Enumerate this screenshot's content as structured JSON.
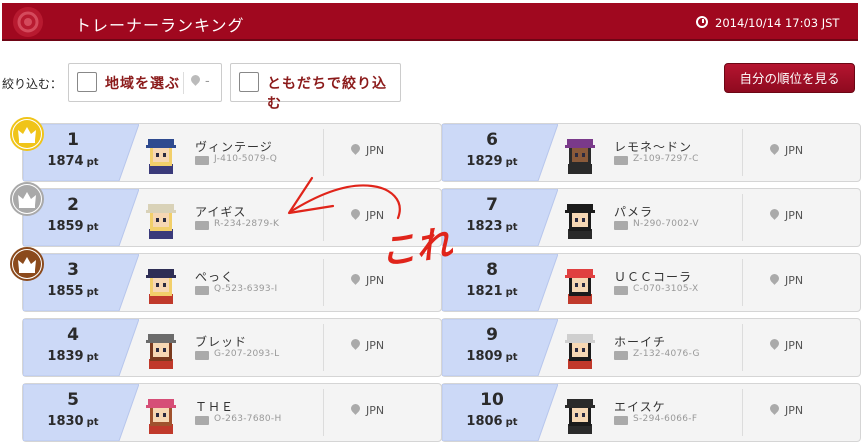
{
  "header": {
    "title": "トレーナーランキング",
    "datetime": "2014/10/14 17:03 JST"
  },
  "filters": {
    "label": "絞り込む：",
    "region_label": "地域を選ぶ",
    "region_value": "-",
    "friends_label": "ともだちで絞り込む"
  },
  "my_rank_button": "自分の順位を見る",
  "pt_unit": "pt",
  "rankings": [
    {
      "rank": "1",
      "points": "1874",
      "name": "ヴィンテージ",
      "id": "J-410-5079-Q",
      "country": "JPN"
    },
    {
      "rank": "2",
      "points": "1859",
      "name": "アイギス",
      "id": "R-234-2879-K",
      "country": "JPN"
    },
    {
      "rank": "3",
      "points": "1855",
      "name": "ぺっく",
      "id": "Q-523-6393-I",
      "country": "JPN"
    },
    {
      "rank": "4",
      "points": "1839",
      "name": "ブレッド",
      "id": "G-207-2093-L",
      "country": "JPN"
    },
    {
      "rank": "5",
      "points": "1830",
      "name": "ＴＨＥ",
      "id": "O-263-7680-H",
      "country": "JPN"
    },
    {
      "rank": "6",
      "points": "1829",
      "name": "レモネ～ドン",
      "id": "Z-109-7297-C",
      "country": "JPN"
    },
    {
      "rank": "7",
      "points": "1823",
      "name": "パメラ",
      "id": "N-290-7002-V",
      "country": "JPN"
    },
    {
      "rank": "8",
      "points": "1821",
      "name": "ＵＣＣコーラ",
      "id": "C-070-3105-X",
      "country": "JPN"
    },
    {
      "rank": "9",
      "points": "1809",
      "name": "ホーイチ",
      "id": "Z-132-4076-G",
      "country": "JPN"
    },
    {
      "rank": "10",
      "points": "1806",
      "name": "エイスケ",
      "id": "S-294-6066-F",
      "country": "JPN"
    }
  ],
  "colors": {
    "header_bg": "#a0081f",
    "gold": "#f0c419",
    "silver": "#a9a9a9",
    "bronze": "#8b4a1c",
    "rank_bg": "#ccd9f7"
  },
  "annotation": {
    "text": "これ"
  }
}
